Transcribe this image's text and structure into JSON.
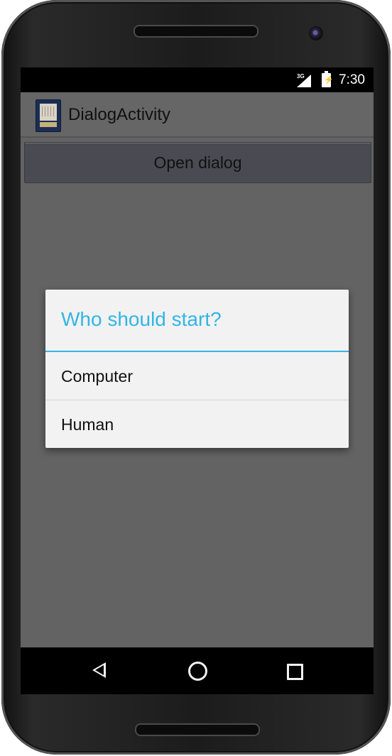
{
  "status": {
    "network": "3G",
    "time": "7:30"
  },
  "app": {
    "title": "DialogActivity",
    "open_button_label": "Open dialog"
  },
  "dialog": {
    "title": "Who should start?",
    "items": [
      {
        "label": "Computer"
      },
      {
        "label": "Human"
      }
    ]
  },
  "colors": {
    "accent": "#33b5e5",
    "background": "#636363",
    "dialog": "#f2f2f2"
  },
  "icons": {
    "back": "back-icon",
    "home": "home-icon",
    "recents": "recents-icon"
  }
}
